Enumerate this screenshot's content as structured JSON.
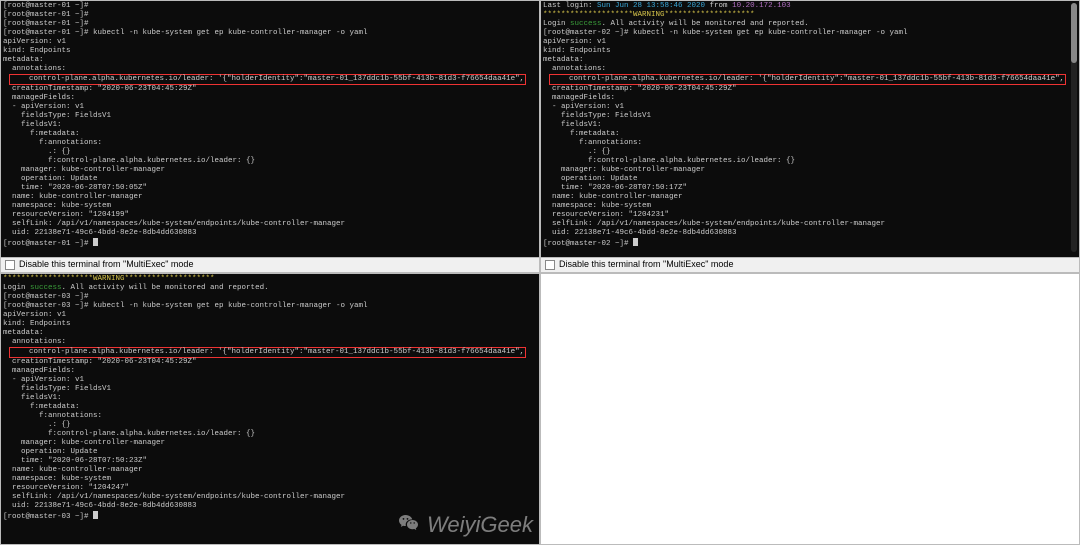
{
  "footer": {
    "checkbox_label": "Disable this terminal from \"MultiExec\" mode"
  },
  "watermark": "WeiyiGeek",
  "p1": {
    "lines_before": [
      "[root@master-01 ~]#",
      "[root@master-01 ~]#",
      "[root@master-01 ~]#",
      "[root@master-01 ~]# kubectl -n kube-system get ep kube-controller-manager -o yaml",
      "apiVersion: v1",
      "kind: Endpoints",
      "metadata:",
      "  annotations:"
    ],
    "annotation": "    control-plane.alpha.kubernetes.io/leader: '{\"holderIdentity\":\"master-01_137ddc1b-55bf-413b-81d3-f76654daa41e\",",
    "lines_after": [
      "  creationTimestamp: \"2020-06-23T04:45:29Z\"",
      "  managedFields:",
      "  - apiVersion: v1",
      "    fieldsType: FieldsV1",
      "    fieldsV1:",
      "      f:metadata:",
      "        f:annotations:",
      "          .: {}",
      "          f:control-plane.alpha.kubernetes.io/leader: {}",
      "    manager: kube-controller-manager",
      "    operation: Update",
      "    time: \"2020-06-28T07:50:05Z\"",
      "  name: kube-controller-manager",
      "  namespace: kube-system",
      "  resourceVersion: \"1204199\"",
      "  selfLink: /api/v1/namespaces/kube-system/endpoints/kube-controller-manager",
      "  uid: 22138e71-49c6-4bdd-8e2e-8db4dd630883"
    ],
    "last_prompt": "[root@master-01 ~]# "
  },
  "p2": {
    "login_parts": {
      "pre": "Last login: ",
      "date": "Sun Jun 28 13:58:46 2020",
      "mid": " from ",
      "ip": "10.20.172.103"
    },
    "warning": "********************WARNING********************",
    "login_success_parts": {
      "pre": "Login ",
      "success": "success",
      "post": ". All activity will be monitored and reported."
    },
    "lines_before": [
      "[root@master-02 ~]# kubectl -n kube-system get ep kube-controller-manager -o yaml",
      "apiVersion: v1",
      "kind: Endpoints",
      "metadata:",
      "  annotations:"
    ],
    "annotation": "    control-plane.alpha.kubernetes.io/leader: '{\"holderIdentity\":\"master-01_137ddc1b-55bf-413b-81d3-f76654daa41e\",",
    "lines_after": [
      "  creationTimestamp: \"2020-06-23T04:45:29Z\"",
      "  managedFields:",
      "  - apiVersion: v1",
      "    fieldsType: FieldsV1",
      "    fieldsV1:",
      "      f:metadata:",
      "        f:annotations:",
      "          .: {}",
      "          f:control-plane.alpha.kubernetes.io/leader: {}",
      "    manager: kube-controller-manager",
      "    operation: Update",
      "    time: \"2020-06-28T07:50:17Z\"",
      "  name: kube-controller-manager",
      "  namespace: kube-system",
      "  resourceVersion: \"1204231\"",
      "  selfLink: /api/v1/namespaces/kube-system/endpoints/kube-controller-manager",
      "  uid: 22138e71-49c6-4bdd-8e2e-8db4dd630883"
    ],
    "last_prompt": "[root@master-02 ~]# "
  },
  "p3": {
    "warning": "********************WARNING********************",
    "login_success_parts": {
      "pre": "Login ",
      "success": "success",
      "post": ". All activity will be monitored and reported."
    },
    "lines_before": [
      "[root@master-03 ~]#",
      "[root@master-03 ~]# kubectl -n kube-system get ep kube-controller-manager -o yaml",
      "apiVersion: v1",
      "kind: Endpoints",
      "metadata:",
      "  annotations:"
    ],
    "annotation": "    control-plane.alpha.kubernetes.io/leader: '{\"holderIdentity\":\"master-01_137ddc1b-55bf-413b-81d3-f76654daa41e\",",
    "lines_after": [
      "  creationTimestamp: \"2020-06-23T04:45:29Z\"",
      "  managedFields:",
      "  - apiVersion: v1",
      "    fieldsType: FieldsV1",
      "    fieldsV1:",
      "      f:metadata:",
      "        f:annotations:",
      "          .: {}",
      "          f:control-plane.alpha.kubernetes.io/leader: {}",
      "    manager: kube-controller-manager",
      "    operation: Update",
      "    time: \"2020-06-28T07:50:23Z\"",
      "  name: kube-controller-manager",
      "  namespace: kube-system",
      "  resourceVersion: \"1204247\"",
      "  selfLink: /api/v1/namespaces/kube-system/endpoints/kube-controller-manager",
      "  uid: 22138e71-49c6-4bdd-8e2e-8db4dd630883"
    ],
    "last_prompt": "[root@master-03 ~]# "
  }
}
